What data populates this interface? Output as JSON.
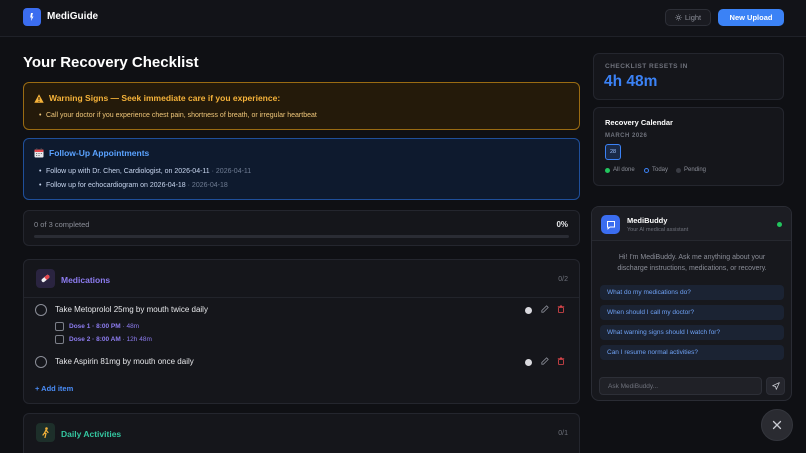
{
  "header": {
    "app_name": "MediGuide",
    "theme_label": "Light",
    "upload_label": "New Upload"
  },
  "page": {
    "title": "Your Recovery Checklist"
  },
  "warning": {
    "title": "Warning Signs — Seek immediate care if you experience:",
    "items": [
      "Call your doctor if you experience chest pain, shortness of breath, or irregular heartbeat"
    ]
  },
  "followup": {
    "title": "Follow-Up Appointments",
    "items": [
      {
        "text": "Follow up with Dr. Chen, Cardiologist, on 2026-04-11",
        "date": " · 2026-04-11"
      },
      {
        "text": "Follow up for echocardiogram on 2026-04-18",
        "date": " · 2026-04-18"
      }
    ]
  },
  "progress": {
    "label": "0 of 3 completed",
    "percent_label": "0%",
    "fraction": 0
  },
  "medications": {
    "title": "Medications",
    "count": "0/2",
    "tasks": [
      {
        "text": "Take Metoprolol 25mg by mouth twice daily",
        "doses": [
          {
            "label": "Dose 1 · 8:00 PM",
            "rel": " · 48m"
          },
          {
            "label": "Dose 2 · 8:00 AM",
            "rel": " · 12h 48m"
          }
        ]
      },
      {
        "text": "Take Aspirin 81mg by mouth once daily"
      }
    ],
    "add_label": "+ Add item"
  },
  "activities": {
    "title": "Daily Activities",
    "count": "0/1"
  },
  "reset": {
    "label": "CHECKLIST RESETS IN",
    "value": "4h 48m"
  },
  "calendar": {
    "title": "Recovery Calendar",
    "month": "MARCH 2026",
    "day": "28",
    "legend": [
      "All done",
      "Today",
      "Pending"
    ],
    "colors": {
      "done": "#22c55e",
      "today": "#3b82f6",
      "pending": "#3a3c44"
    }
  },
  "chat": {
    "name": "MediBuddy",
    "subtitle": "Your AI medical assistant",
    "greeting": "Hi! I'm MediBuddy. Ask me anything about your discharge instructions, medications, or recovery.",
    "suggestions": [
      "What do my medications do?",
      "When should I call my doctor?",
      "What warning signs should I watch for?",
      "Can I resume normal activities?"
    ],
    "input_placeholder": "Ask MediBuddy..."
  },
  "colors": {
    "accent": "#3b82f6",
    "warning": "#f6b33a",
    "danger": "#e5484d",
    "success": "#22c55e"
  }
}
